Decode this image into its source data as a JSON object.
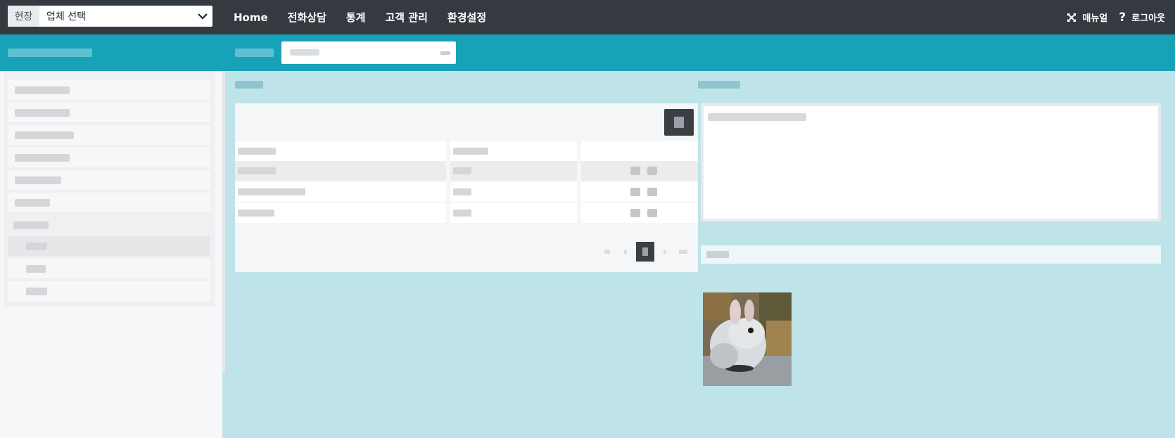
{
  "topbar": {
    "site_prefix": "현장",
    "site_value": "업체 선택",
    "nav": [
      "Home",
      "전화상담",
      "통계",
      "고객 관리",
      "환경설정"
    ],
    "tools": {
      "manual": "매뉴얼",
      "logout": "로그아웃"
    }
  },
  "colors": {
    "topbar": "#343a40",
    "accent": "#17a2b8",
    "main_bg": "#bee4ea",
    "sidebar_bg": "#f7f7f9"
  },
  "icons": {
    "fullscreen": "expand-icon",
    "help": "question-icon",
    "dropdown": "chevron-down-icon"
  }
}
